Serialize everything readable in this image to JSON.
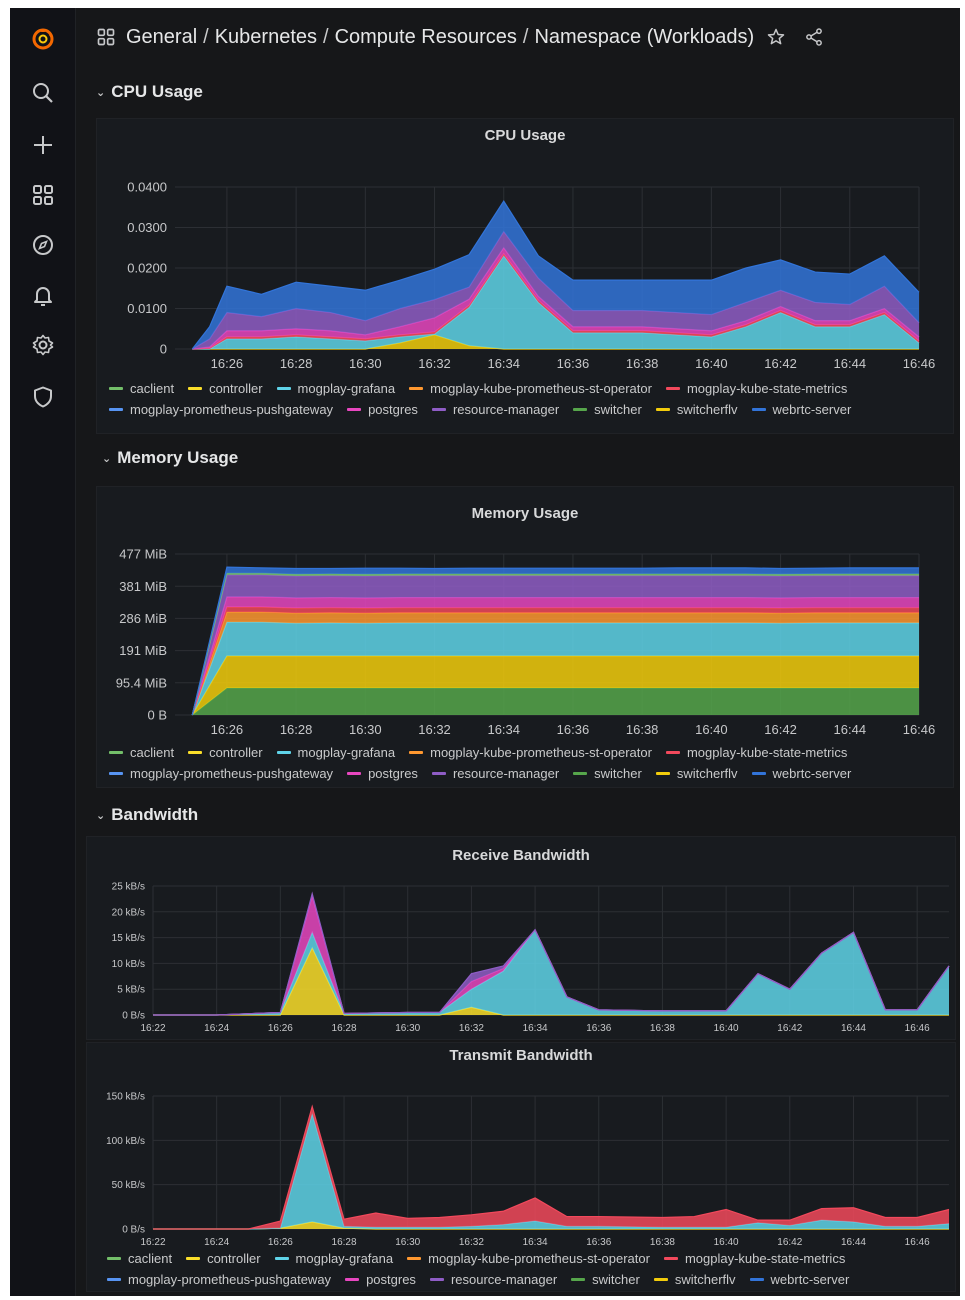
{
  "breadcrumb": {
    "items": [
      "General",
      "Kubernetes",
      "Compute Resources",
      "Namespace (Workloads)"
    ]
  },
  "sidebar": {
    "items": [
      "grafana-logo",
      "search-icon",
      "plus-icon",
      "dashboards-icon",
      "explore-icon",
      "alerting-icon",
      "configuration-icon",
      "shield-icon"
    ]
  },
  "rows": {
    "cpu": "CPU Usage",
    "memory": "Memory Usage",
    "bandwidth": "Bandwidth"
  },
  "legend": {
    "row1": [
      {
        "name": "caclient",
        "color": "#73bf69"
      },
      {
        "name": "controller",
        "color": "#fade2a"
      },
      {
        "name": "mogplay-grafana",
        "color": "#5fd3e8"
      },
      {
        "name": "mogplay-kube-prometheus-st-operator",
        "color": "#ff9830"
      },
      {
        "name": "mogplay-kube-state-metrics",
        "color": "#f2495c"
      }
    ],
    "row2": [
      {
        "name": "mogplay-prometheus-pushgateway",
        "color": "#5794f2"
      },
      {
        "name": "postgres",
        "color": "#e847c0"
      },
      {
        "name": "resource-manager",
        "color": "#8f5dc6"
      },
      {
        "name": "switcher",
        "color": "#56a64b"
      },
      {
        "name": "switcherflv",
        "color": "#f2cc0c"
      },
      {
        "name": "webrtc-server",
        "color": "#3274d9"
      }
    ]
  },
  "chart_data": [
    {
      "title": "CPU Usage",
      "type": "area",
      "stacked": true,
      "x": [
        "16:25",
        "16:25:30",
        "16:26",
        "16:27",
        "16:28",
        "16:29",
        "16:30",
        "16:31",
        "16:32",
        "16:33",
        "16:34",
        "16:35",
        "16:36",
        "16:37",
        "16:38",
        "16:39",
        "16:40",
        "16:41",
        "16:42",
        "16:43",
        "16:44",
        "16:45",
        "16:46"
      ],
      "xticks": [
        "16:26",
        "16:28",
        "16:30",
        "16:32",
        "16:34",
        "16:36",
        "16:38",
        "16:40",
        "16:42",
        "16:44",
        "16:46"
      ],
      "yticks": [
        "0",
        "0.0100",
        "0.0200",
        "0.0300",
        "0.0400"
      ],
      "ylim": [
        0,
        0.04
      ],
      "series": [
        {
          "name": "switcherflv",
          "color": "#f2cc0c",
          "values": [
            0,
            0,
            0,
            0,
            0,
            0,
            0,
            0.0015,
            0.0035,
            0.0008,
            0,
            0,
            0,
            0,
            0,
            0,
            0,
            0,
            0,
            0,
            0,
            0,
            0
          ]
        },
        {
          "name": "mogplay-grafana",
          "color": "#5fd3e8",
          "values": [
            0,
            0,
            0.0025,
            0.0025,
            0.003,
            0.0025,
            0.002,
            0.0015,
            0.0002,
            0.0095,
            0.023,
            0.0115,
            0.004,
            0.004,
            0.004,
            0.0035,
            0.003,
            0.0055,
            0.009,
            0.0055,
            0.0055,
            0.0085,
            0.0015
          ]
        },
        {
          "name": "mogplay-kube-state-metrics",
          "color": "#f2495c",
          "values": [
            0,
            0.0002,
            0.0005,
            0.0005,
            0.0005,
            0.0005,
            0.0005,
            0.0005,
            0.0005,
            0.0005,
            0.0005,
            0.0005,
            0.0005,
            0.0005,
            0.0005,
            0.0005,
            0.0005,
            0.0005,
            0.0005,
            0.0005,
            0.0005,
            0.0005,
            0.0005
          ]
        },
        {
          "name": "postgres",
          "color": "#e847c0",
          "values": [
            0,
            0.0003,
            0.0015,
            0.0015,
            0.0015,
            0.0015,
            0.001,
            0.002,
            0.0035,
            0.0015,
            0.0015,
            0.001,
            0.001,
            0.001,
            0.001,
            0.001,
            0.001,
            0.001,
            0.001,
            0.001,
            0.001,
            0.001,
            0.001
          ]
        },
        {
          "name": "resource-manager",
          "color": "#8f5dc6",
          "values": [
            0,
            0.002,
            0.0045,
            0.0035,
            0.005,
            0.0045,
            0.0035,
            0.0045,
            0.0045,
            0.003,
            0.004,
            0.0045,
            0.004,
            0.004,
            0.004,
            0.004,
            0.004,
            0.0045,
            0.004,
            0.0045,
            0.004,
            0.0055,
            0.0035
          ]
        },
        {
          "name": "webrtc-server",
          "color": "#3274d9",
          "values": [
            0,
            0.003,
            0.0065,
            0.0055,
            0.0065,
            0.0065,
            0.0075,
            0.007,
            0.0075,
            0.008,
            0.0075,
            0.0055,
            0.0075,
            0.0075,
            0.0075,
            0.008,
            0.0085,
            0.0085,
            0.0075,
            0.0075,
            0.0075,
            0.0075,
            0.0075
          ]
        }
      ]
    },
    {
      "title": "Memory Usage",
      "type": "area",
      "stacked": true,
      "x": [
        "16:25",
        "16:26",
        "16:27",
        "16:28",
        "16:29",
        "16:30",
        "16:31",
        "16:32",
        "16:33",
        "16:34",
        "16:35",
        "16:36",
        "16:37",
        "16:38",
        "16:39",
        "16:40",
        "16:41",
        "16:42",
        "16:43",
        "16:44",
        "16:45",
        "16:46"
      ],
      "xticks": [
        "16:26",
        "16:28",
        "16:30",
        "16:32",
        "16:34",
        "16:36",
        "16:38",
        "16:40",
        "16:42",
        "16:44",
        "16:46"
      ],
      "yticks": [
        "0 B",
        "95.4 MiB",
        "191 MiB",
        "286 MiB",
        "381 MiB",
        "477 MiB"
      ],
      "ylim": [
        0,
        477
      ],
      "series": [
        {
          "name": "switcher",
          "color": "#56a64b",
          "values": [
            0,
            80,
            80,
            80,
            80,
            80,
            80,
            80,
            80,
            80,
            80,
            80,
            80,
            80,
            80,
            80,
            80,
            80,
            80,
            80,
            80,
            80
          ]
        },
        {
          "name": "switcherflv",
          "color": "#f2cc0c",
          "values": [
            0,
            95,
            95,
            95,
            95,
            95,
            95,
            95,
            95,
            95,
            95,
            95,
            95,
            95,
            95,
            95,
            95,
            95,
            95,
            95,
            95,
            95
          ]
        },
        {
          "name": "mogplay-grafana",
          "color": "#5fd3e8",
          "values": [
            0,
            100,
            100,
            97,
            98,
            97,
            98,
            98,
            98,
            98,
            98,
            98,
            98,
            98,
            98,
            98,
            98,
            97,
            98,
            98,
            98,
            98
          ]
        },
        {
          "name": "mogplay-kube-prometheus-st-operator",
          "color": "#ff9830",
          "values": [
            0,
            30,
            30,
            30,
            30,
            30,
            30,
            30,
            30,
            30,
            30,
            30,
            30,
            30,
            30,
            30,
            30,
            30,
            30,
            30,
            30,
            30
          ]
        },
        {
          "name": "mogplay-kube-state-metrics",
          "color": "#f2495c",
          "values": [
            0,
            15,
            15,
            15,
            15,
            15,
            15,
            15,
            15,
            15,
            15,
            15,
            15,
            15,
            15,
            15,
            15,
            15,
            15,
            15,
            15,
            15
          ]
        },
        {
          "name": "postgres",
          "color": "#e847c0",
          "values": [
            0,
            30,
            30,
            30,
            30,
            30,
            30,
            30,
            30,
            30,
            30,
            30,
            30,
            30,
            30,
            30,
            30,
            30,
            30,
            30,
            30,
            30
          ]
        },
        {
          "name": "resource-manager",
          "color": "#8f5dc6",
          "values": [
            0,
            65,
            65,
            65,
            65,
            65,
            65,
            65,
            65,
            65,
            65,
            65,
            65,
            65,
            65,
            65,
            65,
            65,
            65,
            65,
            65,
            65
          ]
        },
        {
          "name": "caclient",
          "color": "#73bf69",
          "values": [
            0,
            5,
            5,
            5,
            5,
            5,
            5,
            5,
            5,
            5,
            5,
            5,
            5,
            5,
            5,
            5,
            5,
            5,
            5,
            5,
            5,
            5
          ]
        },
        {
          "name": "webrtc-server",
          "color": "#3274d9",
          "values": [
            0,
            18,
            16,
            17,
            16,
            18,
            17,
            16,
            17,
            17,
            17,
            17,
            17,
            17,
            18,
            18,
            18,
            17,
            17,
            18,
            18,
            18
          ]
        }
      ]
    },
    {
      "title": "Receive Bandwidth",
      "type": "area",
      "stacked": true,
      "x": [
        "16:22",
        "16:24",
        "16:26",
        "16:27",
        "16:28",
        "16:30",
        "16:31",
        "16:32",
        "16:33",
        "16:34",
        "16:35",
        "16:36",
        "16:38",
        "16:40",
        "16:41",
        "16:42",
        "16:43",
        "16:44",
        "16:45",
        "16:46",
        "16:47"
      ],
      "xticks": [
        "16:22",
        "16:24",
        "16:26",
        "16:28",
        "16:30",
        "16:32",
        "16:34",
        "16:36",
        "16:38",
        "16:40",
        "16:42",
        "16:44",
        "16:46"
      ],
      "yticks": [
        "0 B/s",
        "5 kB/s",
        "10 kB/s",
        "15 kB/s",
        "20 kB/s",
        "25 kB/s"
      ],
      "ylim": [
        0,
        25
      ],
      "series": [
        {
          "name": "controller",
          "color": "#fade2a",
          "values": [
            0,
            0,
            0,
            13,
            0,
            0,
            0,
            1.5,
            0,
            0,
            0,
            0,
            0,
            0,
            0,
            0,
            0,
            0,
            0,
            0,
            0
          ]
        },
        {
          "name": "mogplay-grafana",
          "color": "#5fd3e8",
          "values": [
            0,
            0,
            0.5,
            3,
            0.3,
            0.5,
            0.5,
            3.5,
            8.5,
            16.5,
            3.5,
            1,
            0.8,
            0.8,
            8,
            5,
            12,
            16,
            1,
            1,
            9.5
          ]
        },
        {
          "name": "postgres",
          "color": "#e847c0",
          "values": [
            0,
            0,
            0,
            7,
            0,
            0,
            0,
            1.5,
            0.5,
            0,
            0,
            0,
            0,
            0,
            0,
            0,
            0,
            0,
            0,
            0,
            0
          ]
        },
        {
          "name": "resource-manager",
          "color": "#8f5dc6",
          "values": [
            0,
            0,
            0,
            0.5,
            0,
            0,
            0,
            1.5,
            0.5,
            0,
            0,
            0,
            0,
            0,
            0,
            0,
            0,
            0,
            0,
            0,
            0
          ]
        }
      ]
    },
    {
      "title": "Transmit Bandwidth",
      "type": "area",
      "stacked": true,
      "x": [
        "16:22",
        "16:24",
        "16:25",
        "16:26",
        "16:27",
        "16:28",
        "16:29",
        "16:30",
        "16:31",
        "16:32",
        "16:33",
        "16:34",
        "16:35",
        "16:36",
        "16:38",
        "16:39",
        "16:40",
        "16:41",
        "16:42",
        "16:43",
        "16:44",
        "16:45",
        "16:46",
        "16:47"
      ],
      "xticks": [
        "16:22",
        "16:24",
        "16:26",
        "16:28",
        "16:30",
        "16:32",
        "16:34",
        "16:36",
        "16:38",
        "16:40",
        "16:42",
        "16:44",
        "16:46"
      ],
      "yticks": [
        "0 B/s",
        "50 kB/s",
        "100 kB/s",
        "150 kB/s"
      ],
      "ylim": [
        0,
        150
      ],
      "series": [
        {
          "name": "controller",
          "color": "#fade2a",
          "values": [
            0,
            0,
            0,
            1,
            8,
            1,
            0,
            0,
            0,
            0,
            0,
            0,
            0,
            0,
            0,
            0,
            0,
            0,
            0,
            0,
            0,
            0,
            0,
            0
          ]
        },
        {
          "name": "mogplay-grafana",
          "color": "#5fd3e8",
          "values": [
            0,
            0,
            0,
            0,
            122,
            2,
            2,
            2,
            2,
            3,
            5,
            9,
            3,
            3,
            2,
            2,
            2,
            7,
            4,
            10,
            8,
            3,
            3,
            6
          ]
        },
        {
          "name": "mogplay-kube-state-metrics",
          "color": "#f2495c",
          "values": [
            0,
            0,
            0,
            8,
            8,
            8,
            16,
            10,
            11,
            13,
            15,
            26,
            11,
            11,
            11,
            12,
            20,
            3,
            6,
            13,
            16,
            10,
            10,
            16
          ]
        }
      ]
    }
  ]
}
